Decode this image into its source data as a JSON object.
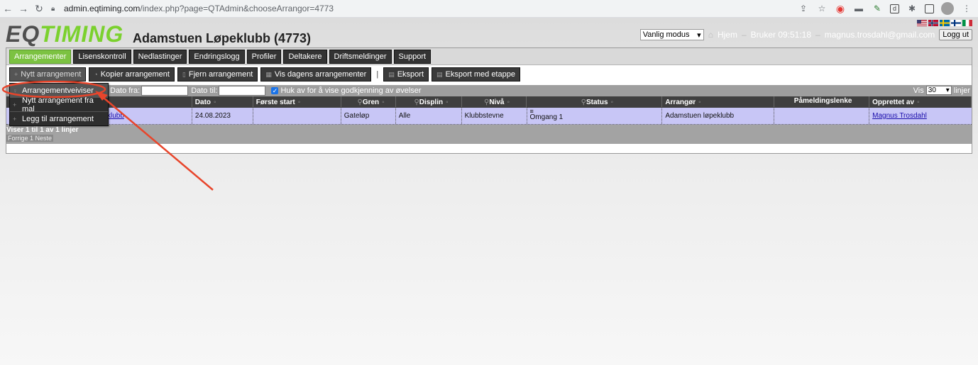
{
  "browser": {
    "url_host": "admin.eqtiming.com",
    "url_path": "/index.php?page=QTAdmin&chooseArrangor=4773"
  },
  "header": {
    "logo_part1": "EQ",
    "logo_part2": "TIMING",
    "club_title": "Adamstuen Løpeklubb (4773)",
    "mode": "Vanlig modus",
    "home": "Hjem",
    "user_info": "Bruker 09:51:18",
    "email": "magnus.trosdahl@gmail.com",
    "logout": "Logg ut"
  },
  "tabs": [
    "Arrangementer",
    "Lisenskontroll",
    "Nedlastinger",
    "Endringslogg",
    "Profiler",
    "Deltakere",
    "Driftsmeldinger",
    "Support"
  ],
  "actions": {
    "new_event": "Nytt arrangement",
    "copy_event": "Kopier arrangement",
    "remove_event": "Fjern arrangement",
    "todays_events": "Vis dagens arrangementer",
    "separator": "|",
    "export": "Eksport",
    "export_stage": "Eksport med etappe"
  },
  "dropdown": {
    "items": [
      "Arrangementveiviser",
      "Nytt arrangement fra mal",
      "Legg til arrangement"
    ]
  },
  "filters": {
    "date_from": "Dato fra:",
    "date_to": "Dato til:",
    "approval_label": "Huk av for å vise godkjenning av øvelser",
    "show_label": "Vis",
    "show_value": "30",
    "lines_label": "linjer"
  },
  "table": {
    "headers": [
      "Dato",
      "Første start",
      "Gren",
      "Displin",
      "Nivå",
      "Status",
      "Arrangør",
      "Påmeldingslenke",
      "Opprettet av"
    ],
    "row": {
      "name_fragment": "klubb",
      "date": "24.08.2023",
      "first_start": "",
      "gren": "Gateløp",
      "displin": "Alle",
      "niva": "Klubbstevne",
      "status": "Omgang 1",
      "arrangor": "Adamstuen løpeklubb",
      "link": "",
      "created_by": "Magnus Trosdahl"
    },
    "showing": "Viser 1 til 1 av 1 linjer",
    "pager": "Forrige 1 Neste"
  },
  "colors": {
    "active_tab": "#7cc242",
    "row_highlight": "#c8c6f6",
    "annotation": "#e8452b"
  }
}
